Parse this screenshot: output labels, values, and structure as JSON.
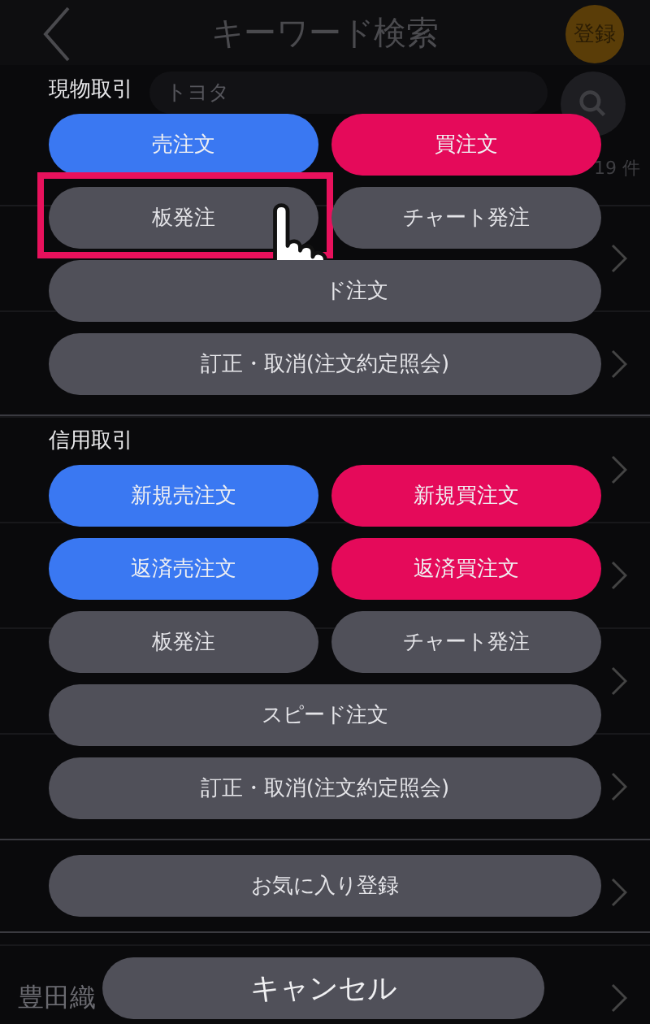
{
  "header": {
    "title": "キーワード検索",
    "register_button": "登録"
  },
  "search": {
    "value": "トヨタ"
  },
  "result_count": "19 件",
  "last_row": "豊田織",
  "sheet": {
    "sections": [
      {
        "title": "現物取引",
        "buttons": [
          {
            "label": "売注文",
            "kind": "sell",
            "highlighted": false
          },
          {
            "label": "買注文",
            "kind": "buy",
            "highlighted": false
          },
          {
            "label": "板発注",
            "kind": "plain",
            "highlighted": true
          },
          {
            "label": "チャート発注",
            "kind": "plain",
            "highlighted": false
          },
          {
            "label": "ド注文",
            "kind": "wide-hidden",
            "highlighted": false
          },
          {
            "label": "訂正・取消(注文約定照会)",
            "kind": "wide",
            "highlighted": false
          }
        ]
      },
      {
        "title": "信用取引",
        "buttons": [
          {
            "label": "新規売注文",
            "kind": "sell",
            "highlighted": false
          },
          {
            "label": "新規買注文",
            "kind": "buy",
            "highlighted": false
          },
          {
            "label": "返済売注文",
            "kind": "sell",
            "highlighted": false
          },
          {
            "label": "返済買注文",
            "kind": "buy",
            "highlighted": false
          },
          {
            "label": "板発注",
            "kind": "plain",
            "highlighted": false
          },
          {
            "label": "チャート発注",
            "kind": "plain",
            "highlighted": false
          },
          {
            "label": "スピード注文",
            "kind": "wide",
            "highlighted": false
          },
          {
            "label": "訂正・取消(注文約定照会)",
            "kind": "wide",
            "highlighted": false
          }
        ]
      },
      {
        "buttons": [
          {
            "label": "お気に入り登録",
            "kind": "wide",
            "highlighted": false
          }
        ]
      }
    ],
    "cancel_button": "キャンセル"
  }
}
